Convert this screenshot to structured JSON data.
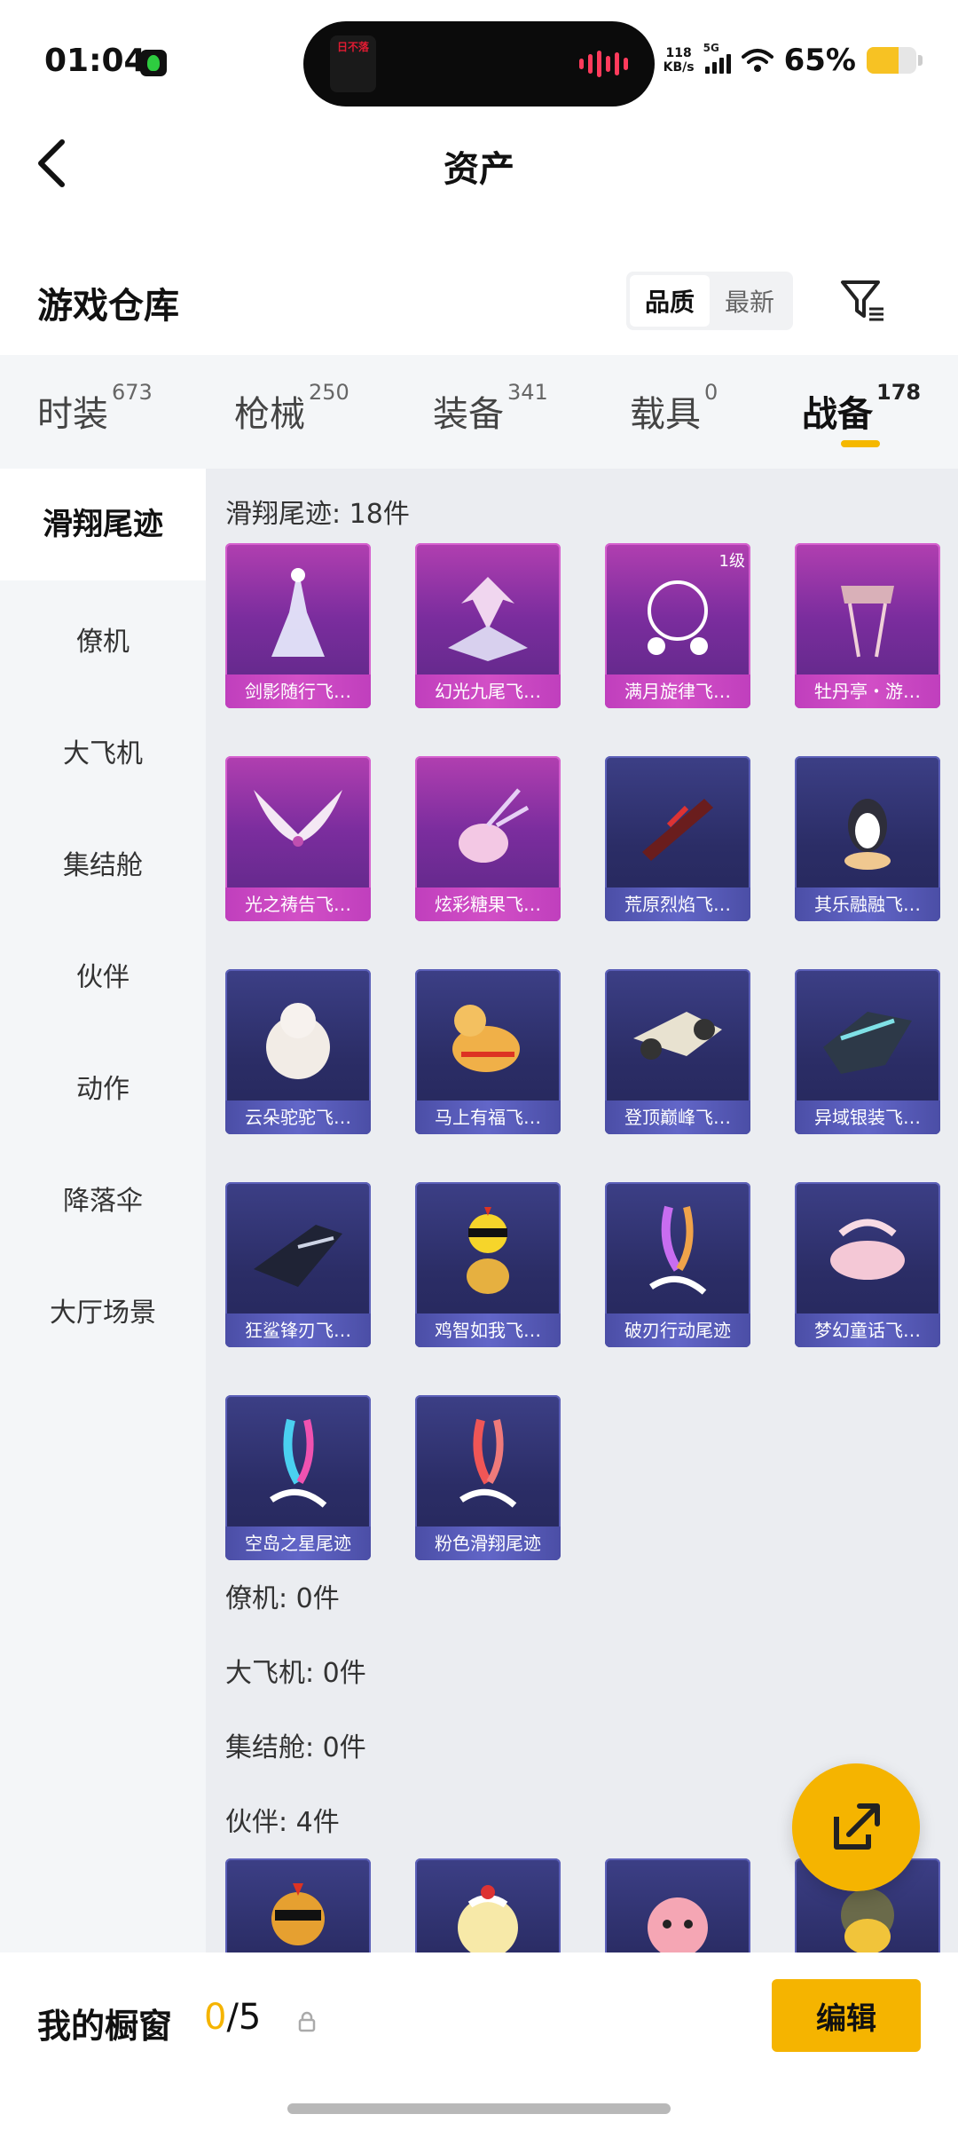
{
  "status": {
    "time": "01:04",
    "island_text": "日不落",
    "speed_top": "118",
    "speed_bottom": "KB/s",
    "network": "5G",
    "battery": "65%",
    "battery_level": 0.65
  },
  "header": {
    "title": "资产"
  },
  "warehouse": {
    "title": "游戏仓库",
    "sort_options": [
      "品质",
      "最新"
    ],
    "active_sort": "品质"
  },
  "tabs": [
    {
      "label": "时装",
      "count": "673"
    },
    {
      "label": "枪械",
      "count": "250"
    },
    {
      "label": "装备",
      "count": "341"
    },
    {
      "label": "载具",
      "count": "0"
    },
    {
      "label": "战备",
      "count": "178"
    }
  ],
  "active_tab": "战备",
  "sidebar": [
    "滑翔尾迹",
    "僚机",
    "大飞机",
    "集结舱",
    "伙伴",
    "动作",
    "降落伞",
    "大厅场景"
  ],
  "sections": {
    "glide_label": "滑翔尾迹: 18件",
    "wingman_label": "僚机: 0件",
    "plane_label": "大飞机: 0件",
    "capsule_label": "集结舱: 0件",
    "partner_label": "伙伴: 4件"
  },
  "glide_items": [
    {
      "name": "剑影随行飞…",
      "rarity": "purple",
      "level": ""
    },
    {
      "name": "幻光九尾飞…",
      "rarity": "purple",
      "level": ""
    },
    {
      "name": "满月旋律飞…",
      "rarity": "purple",
      "level": "1级"
    },
    {
      "name": "牡丹亭・游…",
      "rarity": "purple",
      "level": ""
    },
    {
      "name": "光之祷告飞…",
      "rarity": "purple",
      "level": ""
    },
    {
      "name": "炫彩糖果飞…",
      "rarity": "purple",
      "level": ""
    },
    {
      "name": "荒原烈焰飞…",
      "rarity": "blue",
      "level": ""
    },
    {
      "name": "其乐融融飞…",
      "rarity": "blue",
      "level": ""
    },
    {
      "name": "云朵驼驼飞…",
      "rarity": "blue",
      "level": ""
    },
    {
      "name": "马上有福飞…",
      "rarity": "blue",
      "level": ""
    },
    {
      "name": "登顶巅峰飞…",
      "rarity": "blue",
      "level": ""
    },
    {
      "name": "异域银装飞…",
      "rarity": "blue",
      "level": ""
    },
    {
      "name": "狂鲨锋刃飞…",
      "rarity": "blue",
      "level": ""
    },
    {
      "name": "鸡智如我飞…",
      "rarity": "blue",
      "level": ""
    },
    {
      "name": "破刃行动尾迹",
      "rarity": "blue",
      "level": ""
    },
    {
      "name": "梦幻童话飞…",
      "rarity": "blue",
      "level": ""
    },
    {
      "name": "空岛之星尾迹",
      "rarity": "blue",
      "level": ""
    },
    {
      "name": "粉色滑翔尾迹",
      "rarity": "blue",
      "level": ""
    }
  ],
  "partner_items": [
    {
      "name": "",
      "rarity": "blue",
      "level": ""
    },
    {
      "name": "",
      "rarity": "blue",
      "level": ""
    },
    {
      "name": "",
      "rarity": "blue",
      "level": ""
    },
    {
      "name": "",
      "rarity": "blue",
      "level": ""
    }
  ],
  "showcase": {
    "label": "我的橱窗",
    "current": "0",
    "total": "/5",
    "edit": "编辑"
  },
  "colors": {
    "accent": "#f5b400",
    "purple": "#b13fb0",
    "blue": "#3c3f86"
  }
}
